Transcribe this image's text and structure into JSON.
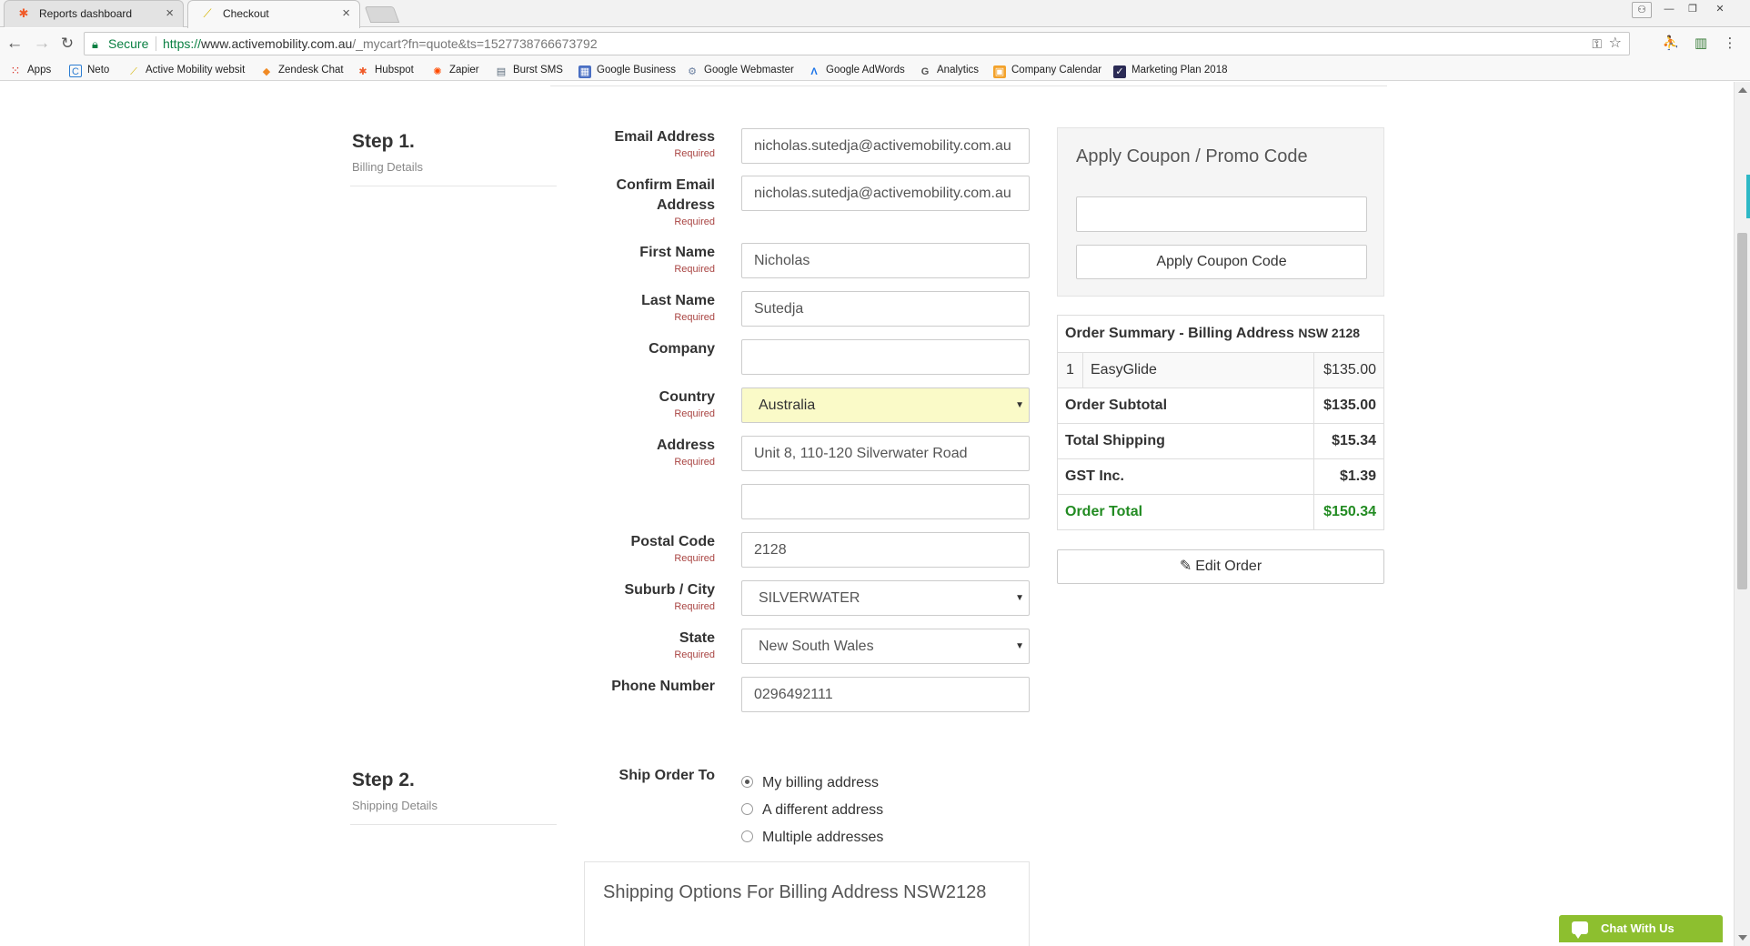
{
  "browser": {
    "tabs": [
      {
        "title": "Reports dashboard",
        "icon": "hubspot-icon"
      },
      {
        "title": "Checkout",
        "icon": "active-mobility-icon"
      }
    ],
    "address": {
      "secure_label": "Secure",
      "scheme": "https://",
      "host": "www.activemobility.com.au",
      "path": "/_mycart?fn=quote&ts=1527738766673792"
    },
    "bookmarks": [
      {
        "label": "Apps",
        "icon": "apps-grid-icon",
        "color": "#d93025"
      },
      {
        "label": "Neto",
        "icon": "neto-icon",
        "color": "#2d7dd2"
      },
      {
        "label": "Active Mobility websit",
        "icon": "active-mobility-icon",
        "color": "#d4b400"
      },
      {
        "label": "Zendesk Chat",
        "icon": "zendesk-icon",
        "color": "#f08a24"
      },
      {
        "label": "Hubspot",
        "icon": "hubspot-icon",
        "color": "#f05a28"
      },
      {
        "label": "Zapier",
        "icon": "zapier-icon",
        "color": "#ff4a00"
      },
      {
        "label": "Burst SMS",
        "icon": "burst-sms-icon",
        "color": "#5a6b7b"
      },
      {
        "label": "Google Business",
        "icon": "google-business-icon",
        "color": "#4a6fc3"
      },
      {
        "label": "Google Webmaster",
        "icon": "google-webmaster-icon",
        "color": "#6a7fa0"
      },
      {
        "label": "Google AdWords",
        "icon": "adwords-icon",
        "color": "#1a73e8"
      },
      {
        "label": "Analytics",
        "icon": "google-g-icon",
        "color": "#555555"
      },
      {
        "label": "Company Calendar",
        "icon": "calendar-icon",
        "color": "#f3a22b"
      },
      {
        "label": "Marketing Plan 2018",
        "icon": "trello-check-icon",
        "color": "#2b2b55"
      }
    ]
  },
  "step1": {
    "title": "Step 1.",
    "subtitle": "Billing Details",
    "required_text": "Required",
    "fields": [
      {
        "label": "Email Address",
        "value": "nicholas.sutedja@activemobility.com.au",
        "required": true
      },
      {
        "label": "Confirm Email",
        "label2": "Address",
        "value": "nicholas.sutedja@activemobility.com.au",
        "required": true
      },
      {
        "label": "First Name",
        "value": "Nicholas",
        "required": true
      },
      {
        "label": "Last Name",
        "value": "Sutedja",
        "required": true
      },
      {
        "label": "Company",
        "value": "",
        "required": false
      },
      {
        "label": "Country",
        "value": "Australia",
        "required": true
      },
      {
        "label": "Address",
        "value": "Unit 8, 110-120 Silverwater Road",
        "value2": "",
        "required": true
      },
      {
        "label": "Postal Code",
        "value": "2128",
        "required": true
      },
      {
        "label": "Suburb / City",
        "value": "SILVERWATER",
        "required": true
      },
      {
        "label": "State",
        "value": "New South Wales",
        "required": true
      },
      {
        "label": "Phone Number",
        "value": "0296492111",
        "required": false
      }
    ]
  },
  "step2": {
    "title": "Step 2.",
    "subtitle": "Shipping Details",
    "ship_label": "Ship Order To",
    "options": [
      "My billing address",
      "A different address",
      "Multiple addresses"
    ],
    "selected": 0,
    "panel_title": "Shipping Options For Billing Address NSW2128"
  },
  "coupon": {
    "title": "Apply Coupon / Promo Code",
    "input_value": "",
    "button": "Apply Coupon Code"
  },
  "summary": {
    "title": "Order Summary - Billing Address",
    "postcode": "NSW 2128",
    "item": {
      "qty": "1",
      "name": "EasyGlide",
      "price": "$135.00"
    },
    "subtotal": {
      "label": "Order Subtotal",
      "value": "$135.00"
    },
    "shipping": {
      "label": "Total Shipping",
      "value": "$15.34"
    },
    "gst": {
      "label": "GST Inc.",
      "value": "$1.39"
    },
    "total": {
      "label": "Order Total",
      "value": "$150.34"
    },
    "edit_button": "Edit Order"
  },
  "chat": {
    "label": "Chat With Us"
  },
  "colors": {
    "accent_green": "#228b22",
    "required_red": "#a94442",
    "chat_green": "#8dbf2f",
    "highlight_yellow": "#fafac8"
  }
}
